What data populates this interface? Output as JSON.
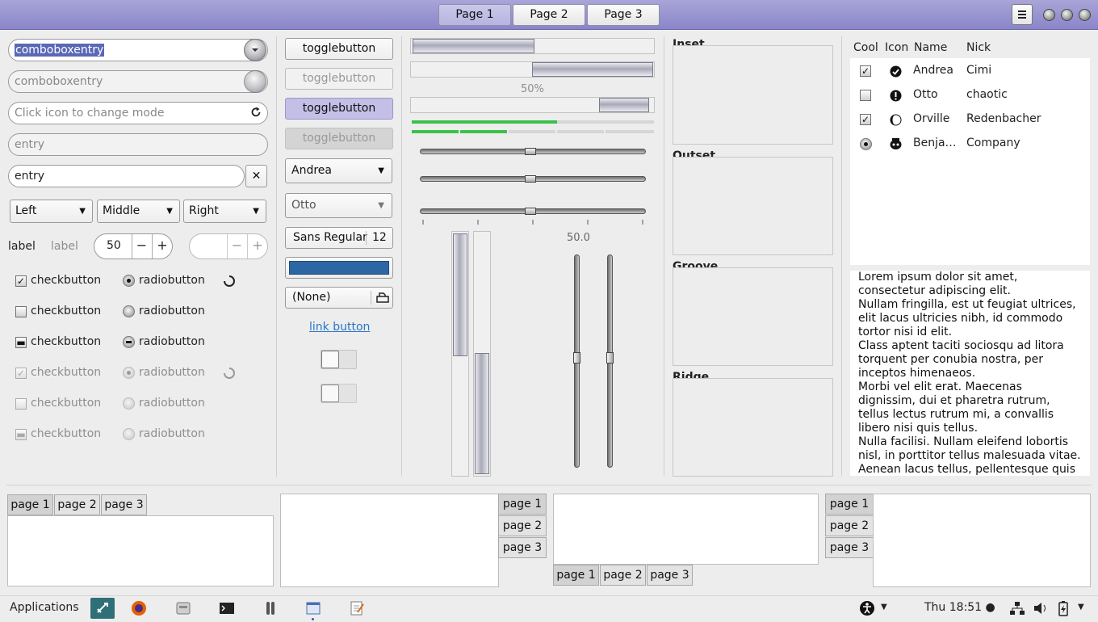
{
  "header": {
    "stack": [
      "Page 1",
      "Page 2",
      "Page 3"
    ],
    "active": 0
  },
  "col1": {
    "combo1": "comboboxentry",
    "combo2": "comboboxentry",
    "icon_entry_placeholder": "Click icon to change mode",
    "entry_disabled": "entry",
    "entry": "entry",
    "links": [
      "Left",
      "Middle",
      "Right"
    ],
    "label": "label",
    "label_dis": "label",
    "spin_value": "50",
    "spin_minus": "−",
    "spin_plus": "+",
    "check_label": "checkbutton",
    "radio_label": "radiobutton"
  },
  "col2": {
    "toggle": "togglebutton",
    "combo_andrea": "Andrea",
    "combo_otto": "Otto",
    "font": "Sans Regular",
    "font_size": "12",
    "color": "#2d67a3",
    "file": "(None)",
    "link": "link button"
  },
  "col3": {
    "pbar_text": "50%",
    "scale_value": "50.0",
    "level_fraction": 0.6
  },
  "frames": [
    "Inset",
    "Outset",
    "Groove",
    "Ridge"
  ],
  "tree": {
    "headers": [
      "Cool",
      "Icon",
      "Name",
      "Nick"
    ],
    "rows": [
      {
        "cool": "checked",
        "icon": "check-circle-icon",
        "name": "Andrea",
        "nick": "Cimi"
      },
      {
        "cool": "unchecked",
        "icon": "exclamation-icon",
        "name": "Otto",
        "nick": "chaotic"
      },
      {
        "cool": "checked",
        "icon": "moon-icon",
        "name": "Orville",
        "nick": "Redenbacher"
      },
      {
        "cool": "radio",
        "icon": "face-icon",
        "name": "Benja…",
        "nick": "Company"
      }
    ]
  },
  "textview": "Lorem ipsum dolor sit amet, consectetur adipiscing elit.\nNullam fringilla, est ut feugiat ultrices, elit lacus ultricies nibh, id commodo tortor nisi id elit.\nClass aptent taciti sociosqu ad litora torquent per conubia nostra, per inceptos himenaeos.\nMorbi vel elit erat. Maecenas dignissim, dui et pharetra rutrum, tellus lectus rutrum mi, a convallis libero nisi quis tellus.\nNulla facilisi. Nullam eleifend lobortis nisl, in porttitor tellus malesuada vitae.\nAenean lacus tellus, pellentesque quis",
  "notebooks": {
    "tabs": [
      "page 1",
      "page 2",
      "page 3"
    ]
  },
  "taskbar": {
    "applications": "Applications",
    "clock": "Thu 18:51 ●"
  }
}
